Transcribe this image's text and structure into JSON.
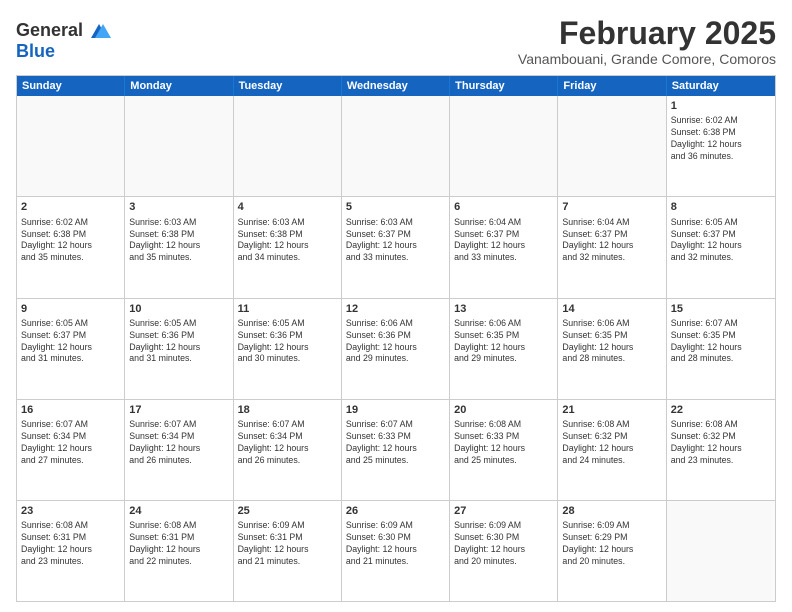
{
  "header": {
    "logo_line1": "General",
    "logo_line2": "Blue",
    "month_title": "February 2025",
    "location": "Vanambouani, Grande Comore, Comoros"
  },
  "weekdays": [
    "Sunday",
    "Monday",
    "Tuesday",
    "Wednesday",
    "Thursday",
    "Friday",
    "Saturday"
  ],
  "rows": [
    [
      {
        "day": "",
        "empty": true,
        "lines": []
      },
      {
        "day": "",
        "empty": true,
        "lines": []
      },
      {
        "day": "",
        "empty": true,
        "lines": []
      },
      {
        "day": "",
        "empty": true,
        "lines": []
      },
      {
        "day": "",
        "empty": true,
        "lines": []
      },
      {
        "day": "",
        "empty": true,
        "lines": []
      },
      {
        "day": "1",
        "empty": false,
        "lines": [
          "Sunrise: 6:02 AM",
          "Sunset: 6:38 PM",
          "Daylight: 12 hours",
          "and 36 minutes."
        ]
      }
    ],
    [
      {
        "day": "2",
        "empty": false,
        "lines": [
          "Sunrise: 6:02 AM",
          "Sunset: 6:38 PM",
          "Daylight: 12 hours",
          "and 35 minutes."
        ]
      },
      {
        "day": "3",
        "empty": false,
        "lines": [
          "Sunrise: 6:03 AM",
          "Sunset: 6:38 PM",
          "Daylight: 12 hours",
          "and 35 minutes."
        ]
      },
      {
        "day": "4",
        "empty": false,
        "lines": [
          "Sunrise: 6:03 AM",
          "Sunset: 6:38 PM",
          "Daylight: 12 hours",
          "and 34 minutes."
        ]
      },
      {
        "day": "5",
        "empty": false,
        "lines": [
          "Sunrise: 6:03 AM",
          "Sunset: 6:37 PM",
          "Daylight: 12 hours",
          "and 33 minutes."
        ]
      },
      {
        "day": "6",
        "empty": false,
        "lines": [
          "Sunrise: 6:04 AM",
          "Sunset: 6:37 PM",
          "Daylight: 12 hours",
          "and 33 minutes."
        ]
      },
      {
        "day": "7",
        "empty": false,
        "lines": [
          "Sunrise: 6:04 AM",
          "Sunset: 6:37 PM",
          "Daylight: 12 hours",
          "and 32 minutes."
        ]
      },
      {
        "day": "8",
        "empty": false,
        "lines": [
          "Sunrise: 6:05 AM",
          "Sunset: 6:37 PM",
          "Daylight: 12 hours",
          "and 32 minutes."
        ]
      }
    ],
    [
      {
        "day": "9",
        "empty": false,
        "lines": [
          "Sunrise: 6:05 AM",
          "Sunset: 6:37 PM",
          "Daylight: 12 hours",
          "and 31 minutes."
        ]
      },
      {
        "day": "10",
        "empty": false,
        "lines": [
          "Sunrise: 6:05 AM",
          "Sunset: 6:36 PM",
          "Daylight: 12 hours",
          "and 31 minutes."
        ]
      },
      {
        "day": "11",
        "empty": false,
        "lines": [
          "Sunrise: 6:05 AM",
          "Sunset: 6:36 PM",
          "Daylight: 12 hours",
          "and 30 minutes."
        ]
      },
      {
        "day": "12",
        "empty": false,
        "lines": [
          "Sunrise: 6:06 AM",
          "Sunset: 6:36 PM",
          "Daylight: 12 hours",
          "and 29 minutes."
        ]
      },
      {
        "day": "13",
        "empty": false,
        "lines": [
          "Sunrise: 6:06 AM",
          "Sunset: 6:35 PM",
          "Daylight: 12 hours",
          "and 29 minutes."
        ]
      },
      {
        "day": "14",
        "empty": false,
        "lines": [
          "Sunrise: 6:06 AM",
          "Sunset: 6:35 PM",
          "Daylight: 12 hours",
          "and 28 minutes."
        ]
      },
      {
        "day": "15",
        "empty": false,
        "lines": [
          "Sunrise: 6:07 AM",
          "Sunset: 6:35 PM",
          "Daylight: 12 hours",
          "and 28 minutes."
        ]
      }
    ],
    [
      {
        "day": "16",
        "empty": false,
        "lines": [
          "Sunrise: 6:07 AM",
          "Sunset: 6:34 PM",
          "Daylight: 12 hours",
          "and 27 minutes."
        ]
      },
      {
        "day": "17",
        "empty": false,
        "lines": [
          "Sunrise: 6:07 AM",
          "Sunset: 6:34 PM",
          "Daylight: 12 hours",
          "and 26 minutes."
        ]
      },
      {
        "day": "18",
        "empty": false,
        "lines": [
          "Sunrise: 6:07 AM",
          "Sunset: 6:34 PM",
          "Daylight: 12 hours",
          "and 26 minutes."
        ]
      },
      {
        "day": "19",
        "empty": false,
        "lines": [
          "Sunrise: 6:07 AM",
          "Sunset: 6:33 PM",
          "Daylight: 12 hours",
          "and 25 minutes."
        ]
      },
      {
        "day": "20",
        "empty": false,
        "lines": [
          "Sunrise: 6:08 AM",
          "Sunset: 6:33 PM",
          "Daylight: 12 hours",
          "and 25 minutes."
        ]
      },
      {
        "day": "21",
        "empty": false,
        "lines": [
          "Sunrise: 6:08 AM",
          "Sunset: 6:32 PM",
          "Daylight: 12 hours",
          "and 24 minutes."
        ]
      },
      {
        "day": "22",
        "empty": false,
        "lines": [
          "Sunrise: 6:08 AM",
          "Sunset: 6:32 PM",
          "Daylight: 12 hours",
          "and 23 minutes."
        ]
      }
    ],
    [
      {
        "day": "23",
        "empty": false,
        "lines": [
          "Sunrise: 6:08 AM",
          "Sunset: 6:31 PM",
          "Daylight: 12 hours",
          "and 23 minutes."
        ]
      },
      {
        "day": "24",
        "empty": false,
        "lines": [
          "Sunrise: 6:08 AM",
          "Sunset: 6:31 PM",
          "Daylight: 12 hours",
          "and 22 minutes."
        ]
      },
      {
        "day": "25",
        "empty": false,
        "lines": [
          "Sunrise: 6:09 AM",
          "Sunset: 6:31 PM",
          "Daylight: 12 hours",
          "and 21 minutes."
        ]
      },
      {
        "day": "26",
        "empty": false,
        "lines": [
          "Sunrise: 6:09 AM",
          "Sunset: 6:30 PM",
          "Daylight: 12 hours",
          "and 21 minutes."
        ]
      },
      {
        "day": "27",
        "empty": false,
        "lines": [
          "Sunrise: 6:09 AM",
          "Sunset: 6:30 PM",
          "Daylight: 12 hours",
          "and 20 minutes."
        ]
      },
      {
        "day": "28",
        "empty": false,
        "lines": [
          "Sunrise: 6:09 AM",
          "Sunset: 6:29 PM",
          "Daylight: 12 hours",
          "and 20 minutes."
        ]
      },
      {
        "day": "",
        "empty": true,
        "lines": []
      }
    ]
  ]
}
